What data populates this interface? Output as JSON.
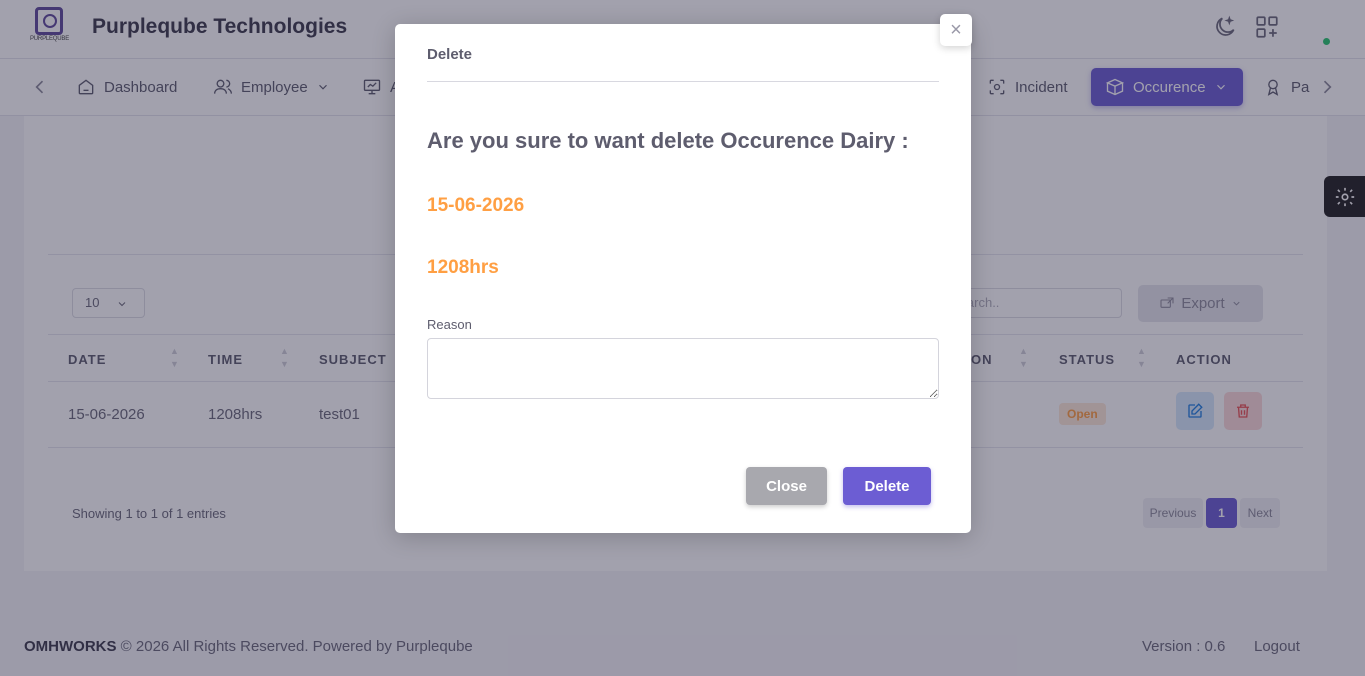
{
  "header": {
    "logo_text": "PURPLEQUBE",
    "brand": "Purpleqube Technologies"
  },
  "nav": {
    "items": [
      {
        "label": "Dashboard"
      },
      {
        "label": "Employee"
      },
      {
        "label": "A"
      },
      {
        "label": "Incident"
      },
      {
        "label": "Occurence"
      },
      {
        "label": "Pa"
      }
    ]
  },
  "table_controls": {
    "page_length": "10",
    "search_placeholder": "Search..",
    "export_label": "Export"
  },
  "table": {
    "columns": [
      "DATE",
      "TIME",
      "SUBJECT",
      "ON",
      "STATUS",
      "ACTION"
    ],
    "rows": [
      {
        "date": "15-06-2026",
        "time": "1208hrs",
        "subject": "test01",
        "status": "Open"
      }
    ]
  },
  "pagination": {
    "info": "Showing 1 to 1 of 1 entries",
    "previous": "Previous",
    "current": "1",
    "next": "Next"
  },
  "footer": {
    "brand": "OMHWORKS",
    "copyright": "© 2026 All Rights Reserved. Powered by Purpleqube",
    "version": "Version : 0.6",
    "logout": "Logout"
  },
  "modal": {
    "title": "Delete",
    "close_x": "×",
    "question": "Are you sure to want delete Occurence Dairy :",
    "date": "15-06-2026",
    "time": "1208hrs",
    "reason_label": "Reason",
    "reason_value": "",
    "close_label": "Close",
    "delete_label": "Delete"
  },
  "colors": {
    "primary": "#6c5dd3",
    "warning": "#ff9f43",
    "danger": "#ea5455",
    "info": "#1e7fe0",
    "success": "#28c76f"
  }
}
